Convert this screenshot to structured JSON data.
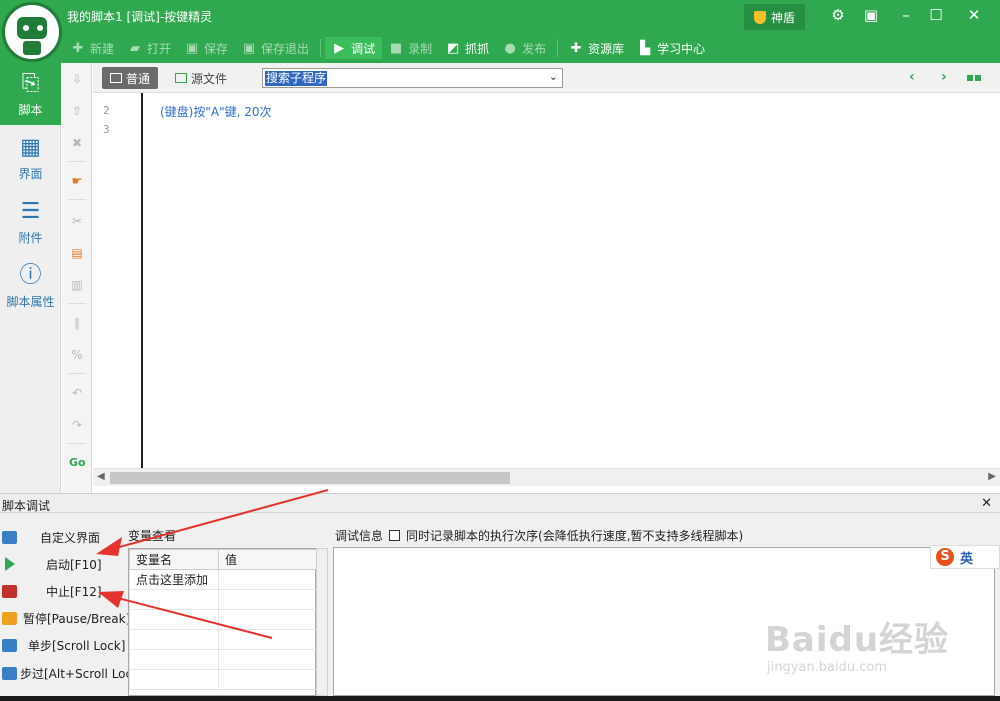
{
  "window": {
    "title": "我的脚本1 [调试]-按键精灵",
    "shield_label": "神盾",
    "controls": [
      "gear-icon",
      "restore-icon",
      "minimize-icon",
      "maximize-icon",
      "close-icon"
    ]
  },
  "toolbar": {
    "items": [
      {
        "label": "新建",
        "icon": "plus-icon",
        "enabled": false
      },
      {
        "label": "打开",
        "icon": "folder-icon",
        "enabled": false
      },
      {
        "label": "保存",
        "icon": "save-icon",
        "enabled": false
      },
      {
        "label": "保存退出",
        "icon": "save-exit-icon",
        "enabled": false
      },
      {
        "label": "调试",
        "icon": "play-icon",
        "enabled": true,
        "selected": true
      },
      {
        "label": "录制",
        "icon": "camera-icon",
        "enabled": false
      },
      {
        "label": "抓抓",
        "icon": "grab-icon",
        "enabled": true
      },
      {
        "label": "发布",
        "icon": "publish-icon",
        "enabled": false
      },
      {
        "label": "资源库",
        "icon": "resource-icon",
        "enabled": true
      },
      {
        "label": "学习中心",
        "icon": "learn-icon",
        "enabled": true
      }
    ]
  },
  "sidebar": {
    "items": [
      {
        "label": "脚本",
        "icon": "script-icon",
        "active": true
      },
      {
        "label": "界面",
        "icon": "ui-grid-icon",
        "active": false
      },
      {
        "label": "附件",
        "icon": "attachment-icon",
        "active": false
      },
      {
        "label": "脚本属性",
        "icon": "info-icon",
        "active": false
      }
    ]
  },
  "edit_strip": {
    "icons": [
      "arrow-down-icon",
      "arrow-up-icon",
      "delete-icon",
      "hand-icon",
      "cut-icon",
      "copy-icon",
      "paste-icon",
      "comment-icon",
      "uncomment-icon",
      "undo-icon",
      "redo-icon",
      "goto-icon"
    ],
    "goto_label": "Go"
  },
  "editor": {
    "modes": [
      {
        "label": "普通",
        "active": true
      },
      {
        "label": "源文件",
        "active": false
      }
    ],
    "subroutine_search": "搜索子程序",
    "lines": [
      {
        "number": "2",
        "text": "(键盘)按\"A\"键, 20次"
      },
      {
        "number": "3",
        "text": ""
      }
    ]
  },
  "debug": {
    "title": "脚本调试",
    "buttons": [
      {
        "label": "自定义界面",
        "icon": "custom-ui-icon",
        "color": "#3a7fc4"
      },
      {
        "label": "启动[F10]",
        "icon": "start-icon",
        "color": "#2fa84f"
      },
      {
        "label": "中止[F12]",
        "icon": "stop-icon",
        "color": "#c0312b"
      },
      {
        "label": "暂停[Pause/Break]",
        "icon": "pause-icon",
        "color": "#f0a020"
      },
      {
        "label": "单步[Scroll Lock]",
        "icon": "step-icon",
        "color": "#3a7fc4"
      },
      {
        "label": "步过[Alt+Scroll Lock]",
        "icon": "step-over-icon",
        "color": "#3a7fc4"
      }
    ],
    "variables": {
      "label": "变量查看",
      "columns": [
        "变量名",
        "值"
      ],
      "rows": [
        [
          "点击这里添加",
          ""
        ]
      ]
    },
    "info": {
      "label": "调试信息",
      "checkbox_label": "同时记录脚本的执行次序(会降低执行速度,暂不支持多线程脚本)",
      "checked": false
    }
  },
  "ime": {
    "label": "英",
    "logo": "S"
  },
  "watermark": {
    "main": "Baidu经验",
    "sub": "jingyan.baidu.com"
  },
  "colors": {
    "brand_green": "#2fa84f",
    "accent_blue": "#2f6fd1",
    "annotation_red": "#e5322d"
  }
}
